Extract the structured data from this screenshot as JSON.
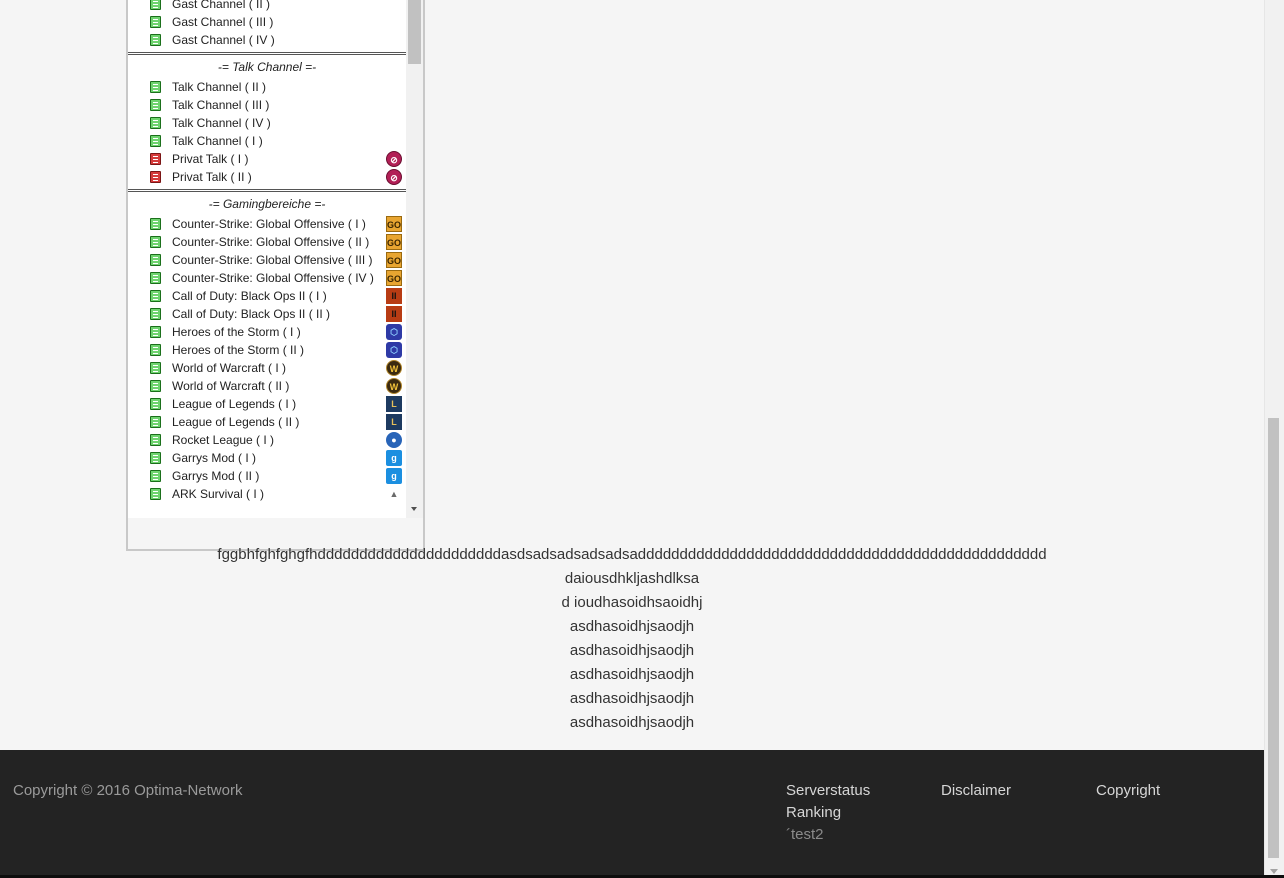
{
  "widget": {
    "top_partial": [
      {
        "label": "Gast Channel ( II )",
        "icon": "channel-open",
        "game": null
      },
      {
        "label": "Gast Channel ( III )",
        "icon": "channel-open",
        "game": null
      },
      {
        "label": "Gast Channel ( IV )",
        "icon": "channel-open",
        "game": null
      }
    ],
    "sections": [
      {
        "title": "-= Talk Channel =-",
        "channels": [
          {
            "label": "Talk Channel ( II )",
            "icon": "channel-open",
            "game": null
          },
          {
            "label": "Talk Channel ( III )",
            "icon": "channel-open",
            "game": null
          },
          {
            "label": "Talk Channel ( IV )",
            "icon": "channel-open",
            "game": null
          },
          {
            "label": "Talk Channel ( I )",
            "icon": "channel-open",
            "game": null
          },
          {
            "label": "Privat Talk ( I )",
            "icon": "channel-locked",
            "game": "private"
          },
          {
            "label": "Privat Talk ( II )",
            "icon": "channel-locked",
            "game": "private"
          }
        ]
      },
      {
        "title": "-= Gamingbereiche =-",
        "channels": [
          {
            "label": "Counter-Strike: Global Offensive ( I )",
            "icon": "channel-open",
            "game": "csgo"
          },
          {
            "label": "Counter-Strike: Global Offensive ( II )",
            "icon": "channel-open",
            "game": "csgo"
          },
          {
            "label": "Counter-Strike: Global Offensive ( III )",
            "icon": "channel-open",
            "game": "csgo"
          },
          {
            "label": "Counter-Strike: Global Offensive ( IV )",
            "icon": "channel-open",
            "game": "csgo"
          },
          {
            "label": "Call of Duty: Black Ops II ( I )",
            "icon": "channel-open",
            "game": "cod"
          },
          {
            "label": "Call of Duty: Black Ops II ( II )",
            "icon": "channel-open",
            "game": "cod"
          },
          {
            "label": "Heroes of the Storm ( I )",
            "icon": "channel-open",
            "game": "hots"
          },
          {
            "label": "Heroes of the Storm ( II )",
            "icon": "channel-open",
            "game": "hots"
          },
          {
            "label": "World of Warcraft ( I )",
            "icon": "channel-open",
            "game": "wow"
          },
          {
            "label": "World of Warcraft ( II )",
            "icon": "channel-open",
            "game": "wow"
          },
          {
            "label": "League of Legends ( I )",
            "icon": "channel-open",
            "game": "lol"
          },
          {
            "label": "League of Legends ( II )",
            "icon": "channel-open",
            "game": "lol"
          },
          {
            "label": "Rocket League ( I )",
            "icon": "channel-open",
            "game": "rocket"
          },
          {
            "label": "Garrys Mod ( I )",
            "icon": "channel-open",
            "game": "gmod"
          },
          {
            "label": "Garrys Mod ( II )",
            "icon": "channel-open",
            "game": "gmod"
          },
          {
            "label": "ARK Survival ( I )",
            "icon": "channel-open",
            "game": "ark"
          }
        ]
      }
    ]
  },
  "content": {
    "lines": [
      "fggbhfghfghgfhddddddddddddddddddddddasdsadsadsadsadsaddddddddddddddddddddddddddddddddddddddddddddddddd",
      "daiousdhkljashdlksa",
      "d ioudhasoidhsaoidhj",
      "asdhasoidhjsaodjh",
      "asdhasoidhjsaodjh",
      "asdhasoidhjsaodjh",
      "asdhasoidhjsaodjh",
      "asdhasoidhjsaodjh"
    ]
  },
  "footer": {
    "copyright": "Copyright © 2016 Optima-Network",
    "links": {
      "serverstatus": "Serverstatus",
      "ranking": "Ranking",
      "test2": "´test2",
      "disclaimer": "Disclaimer",
      "copyright": "Copyright"
    }
  },
  "colors": {
    "background": "#f5f5f5",
    "footer_bg": "#232323",
    "channel_open": "#6ed36e",
    "channel_locked": "#d43a3a"
  },
  "game_icon_glyphs": {
    "csgo": "GO",
    "cod": "II",
    "hots": "⬡",
    "wow": "W",
    "lol": "L",
    "rocket": "●",
    "gmod": "g",
    "ark": "▲",
    "private": "⊘"
  }
}
